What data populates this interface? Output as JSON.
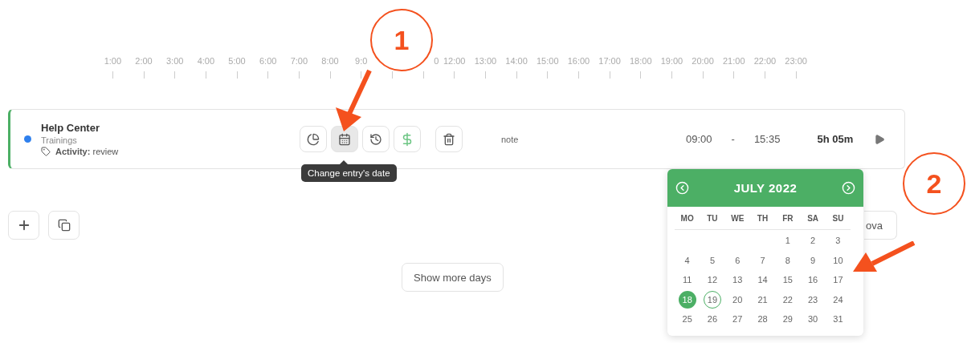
{
  "timeline": [
    {
      "label": "1:00"
    },
    {
      "label": "2:00"
    },
    {
      "label": "3:00"
    },
    {
      "label": "4:00"
    },
    {
      "label": "5:00"
    },
    {
      "label": "6:00"
    },
    {
      "label": "7:00"
    },
    {
      "label": "8:00"
    },
    {
      "label": "9:0"
    },
    {
      "kind": "tick"
    },
    {
      "label": "0",
      "kind": "partial"
    },
    {
      "label": "12:00"
    },
    {
      "label": "13:00"
    },
    {
      "label": "14:00"
    },
    {
      "label": "15:00"
    },
    {
      "label": "16:00"
    },
    {
      "label": "17:00"
    },
    {
      "label": "18:00"
    },
    {
      "label": "19:00"
    },
    {
      "label": "20:00"
    },
    {
      "label": "21:00"
    },
    {
      "label": "22:00"
    },
    {
      "label": "23:00"
    }
  ],
  "entry": {
    "project": "Help Center",
    "color": "#2f80ed",
    "client": "Trainings",
    "tag_label": "Activity:",
    "tag_value": "review",
    "actions": [
      {
        "kind": "chart",
        "selected": false
      },
      {
        "kind": "calendar",
        "selected": true
      },
      {
        "kind": "history",
        "selected": false
      },
      {
        "kind": "billable",
        "selected": false
      },
      {
        "kind": "delete",
        "selected": false
      }
    ],
    "note": "note",
    "start": "09:00",
    "separator": "-",
    "end": "15:35",
    "duration": "5h 05m"
  },
  "tooltip": "Change entry's date",
  "side_button": "ova",
  "show_more": "Show more days",
  "calendar": {
    "title": "JULY 2022",
    "weekdays": [
      "MO",
      "TU",
      "WE",
      "TH",
      "FR",
      "SA",
      "SU"
    ],
    "weeks": [
      [
        {
          "day": "1",
          "selected": false,
          "today": false
        },
        {
          "day": "2",
          "selected": false,
          "today": false
        },
        {
          "day": "3",
          "selected": false,
          "today": false
        }
      ],
      [
        {
          "day": "4",
          "selected": false,
          "today": false
        },
        {
          "day": "5",
          "selected": false,
          "today": false
        },
        {
          "day": "6",
          "selected": false,
          "today": false
        },
        {
          "day": "7",
          "selected": false,
          "today": false
        },
        {
          "day": "8",
          "selected": false,
          "today": false
        },
        {
          "day": "9",
          "selected": false,
          "today": false
        },
        {
          "day": "10",
          "selected": false,
          "today": false
        }
      ],
      [
        {
          "day": "11",
          "selected": false,
          "today": false
        },
        {
          "day": "12",
          "selected": false,
          "today": false
        },
        {
          "day": "13",
          "selected": false,
          "today": false
        },
        {
          "day": "14",
          "selected": false,
          "today": false
        },
        {
          "day": "15",
          "selected": false,
          "today": false
        },
        {
          "day": "16",
          "selected": false,
          "today": false
        },
        {
          "day": "17",
          "selected": false,
          "today": false
        }
      ],
      [
        {
          "day": "18",
          "selected": true,
          "today": false
        },
        {
          "day": "19",
          "selected": false,
          "today": true
        },
        {
          "day": "20",
          "selected": false,
          "today": false
        },
        {
          "day": "21",
          "selected": false,
          "today": false
        },
        {
          "day": "22",
          "selected": false,
          "today": false
        },
        {
          "day": "23",
          "selected": false,
          "today": false
        },
        {
          "day": "24",
          "selected": false,
          "today": false
        }
      ],
      [
        {
          "day": "25",
          "selected": false,
          "today": false
        },
        {
          "day": "26",
          "selected": false,
          "today": false
        },
        {
          "day": "27",
          "selected": false,
          "today": false
        },
        {
          "day": "28",
          "selected": false,
          "today": false
        },
        {
          "day": "29",
          "selected": false,
          "today": false
        },
        {
          "day": "30",
          "selected": false,
          "today": false
        },
        {
          "day": "31",
          "selected": false,
          "today": false
        }
      ]
    ]
  },
  "callouts": [
    "1",
    "2"
  ]
}
